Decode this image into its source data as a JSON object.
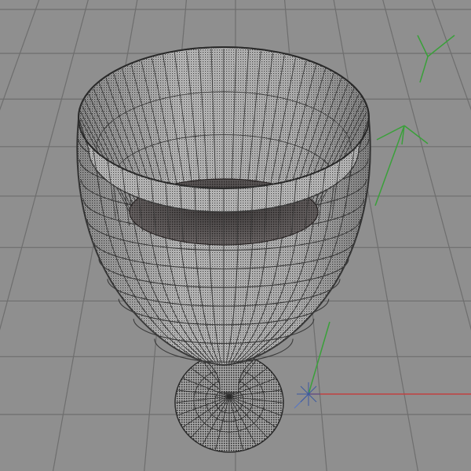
{
  "viewport": {
    "background": "#8f8f8f",
    "grid_color": "#6e6e6e",
    "mesh_fill": "#c4c4c4",
    "mesh_wire": "#3a3a3a",
    "interior_fill": "#5a5656",
    "axis_x_color": "#c04040",
    "axis_y_color": "#3aa03a",
    "axis_z_color": "#3a6fd0"
  },
  "scene": {
    "object": "goblet-mesh",
    "view": "perspective",
    "display_mode": "wireframe-shaded",
    "icons": [
      "world-axis-gizmo-icon",
      "view-orientation-gizmo-icon"
    ]
  }
}
